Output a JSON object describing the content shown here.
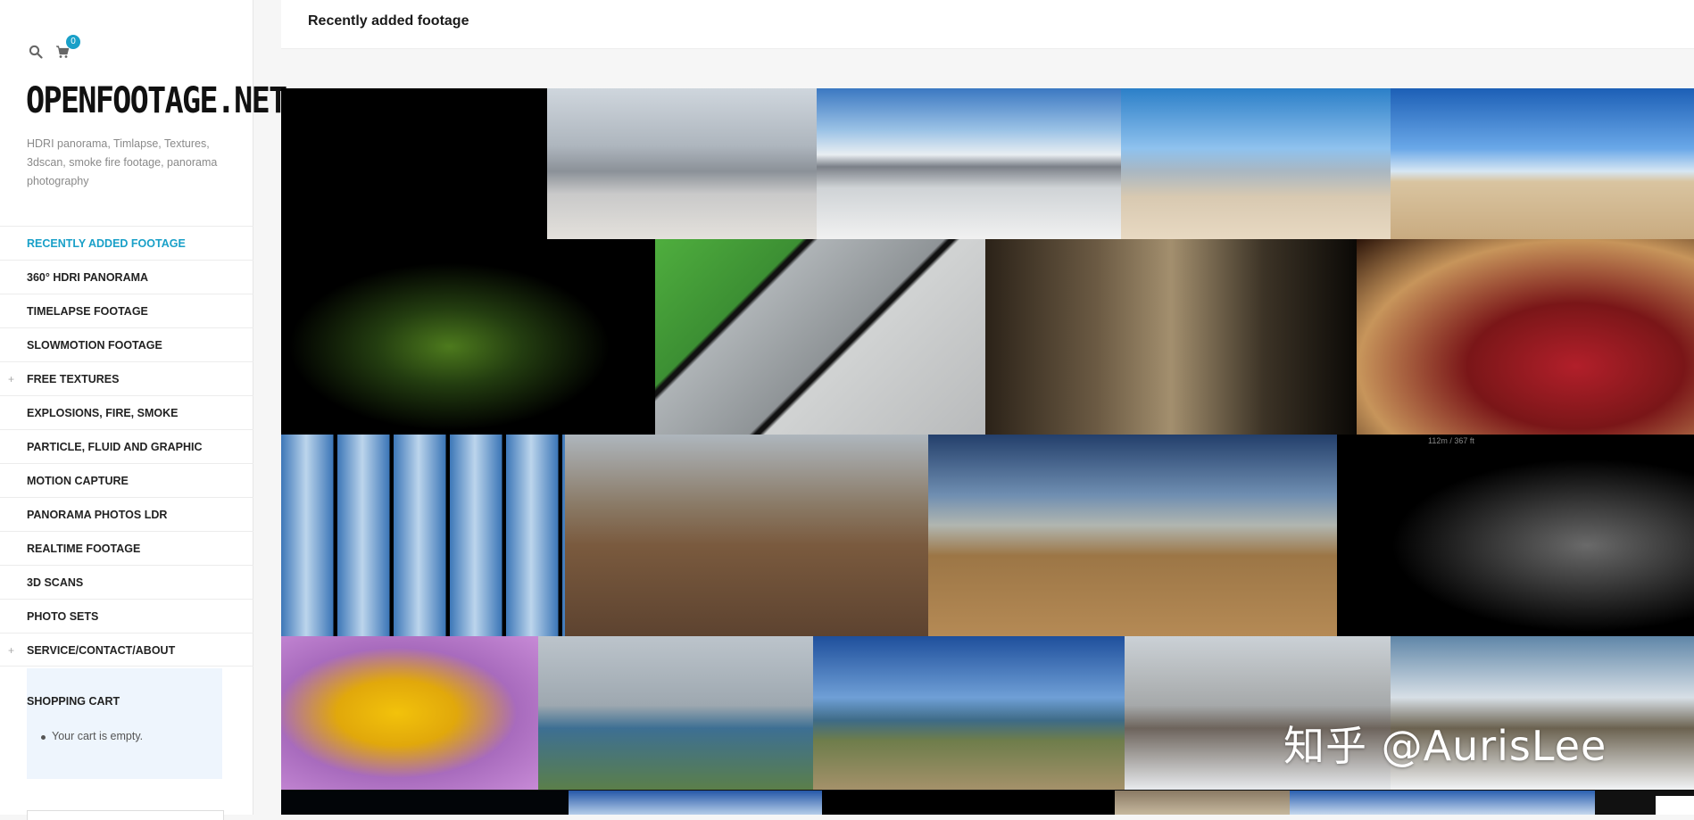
{
  "site": {
    "logo": "OPENFOOTAGE.NET",
    "tagline": "HDRI panorama, Timlapse, Textures, 3dscan, smoke fire footage, panorama photography",
    "cart_count": "0"
  },
  "icons": {
    "search": "search-icon",
    "cart": "shopping-cart-icon"
  },
  "nav": [
    {
      "label": "Recently added footage",
      "active": true,
      "expandable": false
    },
    {
      "label": "360° HDRI Panorama",
      "active": false,
      "expandable": false
    },
    {
      "label": "Timelapse footage",
      "active": false,
      "expandable": false
    },
    {
      "label": "Slowmotion footage",
      "active": false,
      "expandable": false
    },
    {
      "label": "Free Textures",
      "active": false,
      "expandable": true
    },
    {
      "label": "Explosions, fire, smoke",
      "active": false,
      "expandable": false
    },
    {
      "label": "Particle, fluid and graphic",
      "active": false,
      "expandable": false
    },
    {
      "label": "Motion capture",
      "active": false,
      "expandable": false
    },
    {
      "label": "Panorama photos LDR",
      "active": false,
      "expandable": false
    },
    {
      "label": "Realtime footage",
      "active": false,
      "expandable": false
    },
    {
      "label": "3D scans",
      "active": false,
      "expandable": false
    },
    {
      "label": "Photo sets",
      "active": false,
      "expandable": false
    },
    {
      "label": "Service/Contact/About",
      "active": false,
      "expandable": true
    }
  ],
  "nav_plus": "+",
  "cart_widget": {
    "title": "Shopping cart",
    "empty_text": "Your cart is empty."
  },
  "main": {
    "title": "Recently added footage"
  },
  "thumb_overlays": {
    "smoke_measure": "112m / 367 ft"
  },
  "watermark": "知乎 @AurisLee",
  "colors": {
    "accent": "#19a0c8",
    "sidebar_bg": "#ffffff",
    "page_bg": "#f6f6f6",
    "cart_widget_bg": "#eef5fd"
  }
}
